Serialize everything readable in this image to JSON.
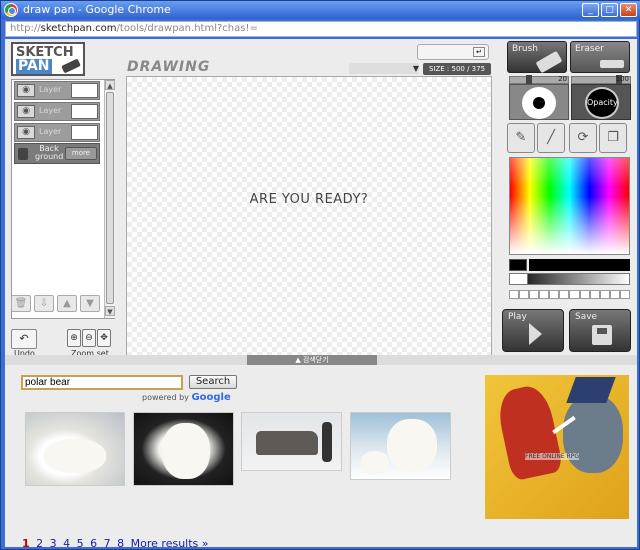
{
  "window": {
    "title": "draw pan - Google Chrome",
    "url_prefix": "http://",
    "url_host": "sketchpan.com",
    "url_path": "/tools/drawpan.html?chas!="
  },
  "logo": {
    "line1": "SKETCH",
    "line2": "PAN"
  },
  "layers": {
    "items": [
      {
        "label": "Layer"
      },
      {
        "label": "Layer"
      },
      {
        "label": "Layer"
      }
    ],
    "background_label": "Back ground",
    "more_label": "more"
  },
  "bottom_tools": {
    "undo_label": "Undo",
    "zoom_label": "Zoom set"
  },
  "canvas": {
    "heading": "DRAWING",
    "size_text": "SIZE : 500 / 375",
    "message": "ARE YOU READY?"
  },
  "tools": {
    "brush_label": "Brush",
    "eraser_label": "Eraser",
    "brush_size": "20",
    "opacity_value": "100",
    "opacity_label": "Opacity",
    "play_label": "Play",
    "save_label": "Save"
  },
  "search_panel": {
    "toggle_label": "검색닫기",
    "query": "polar bear",
    "search_button": "Search",
    "powered_by": "powered by",
    "powered_brand": "Google",
    "pages": [
      "1",
      "2",
      "3",
      "4",
      "5",
      "6",
      "7",
      "8"
    ],
    "more_results": "More results »"
  },
  "ad": {
    "caption": "FREE ONLINE RPG"
  }
}
